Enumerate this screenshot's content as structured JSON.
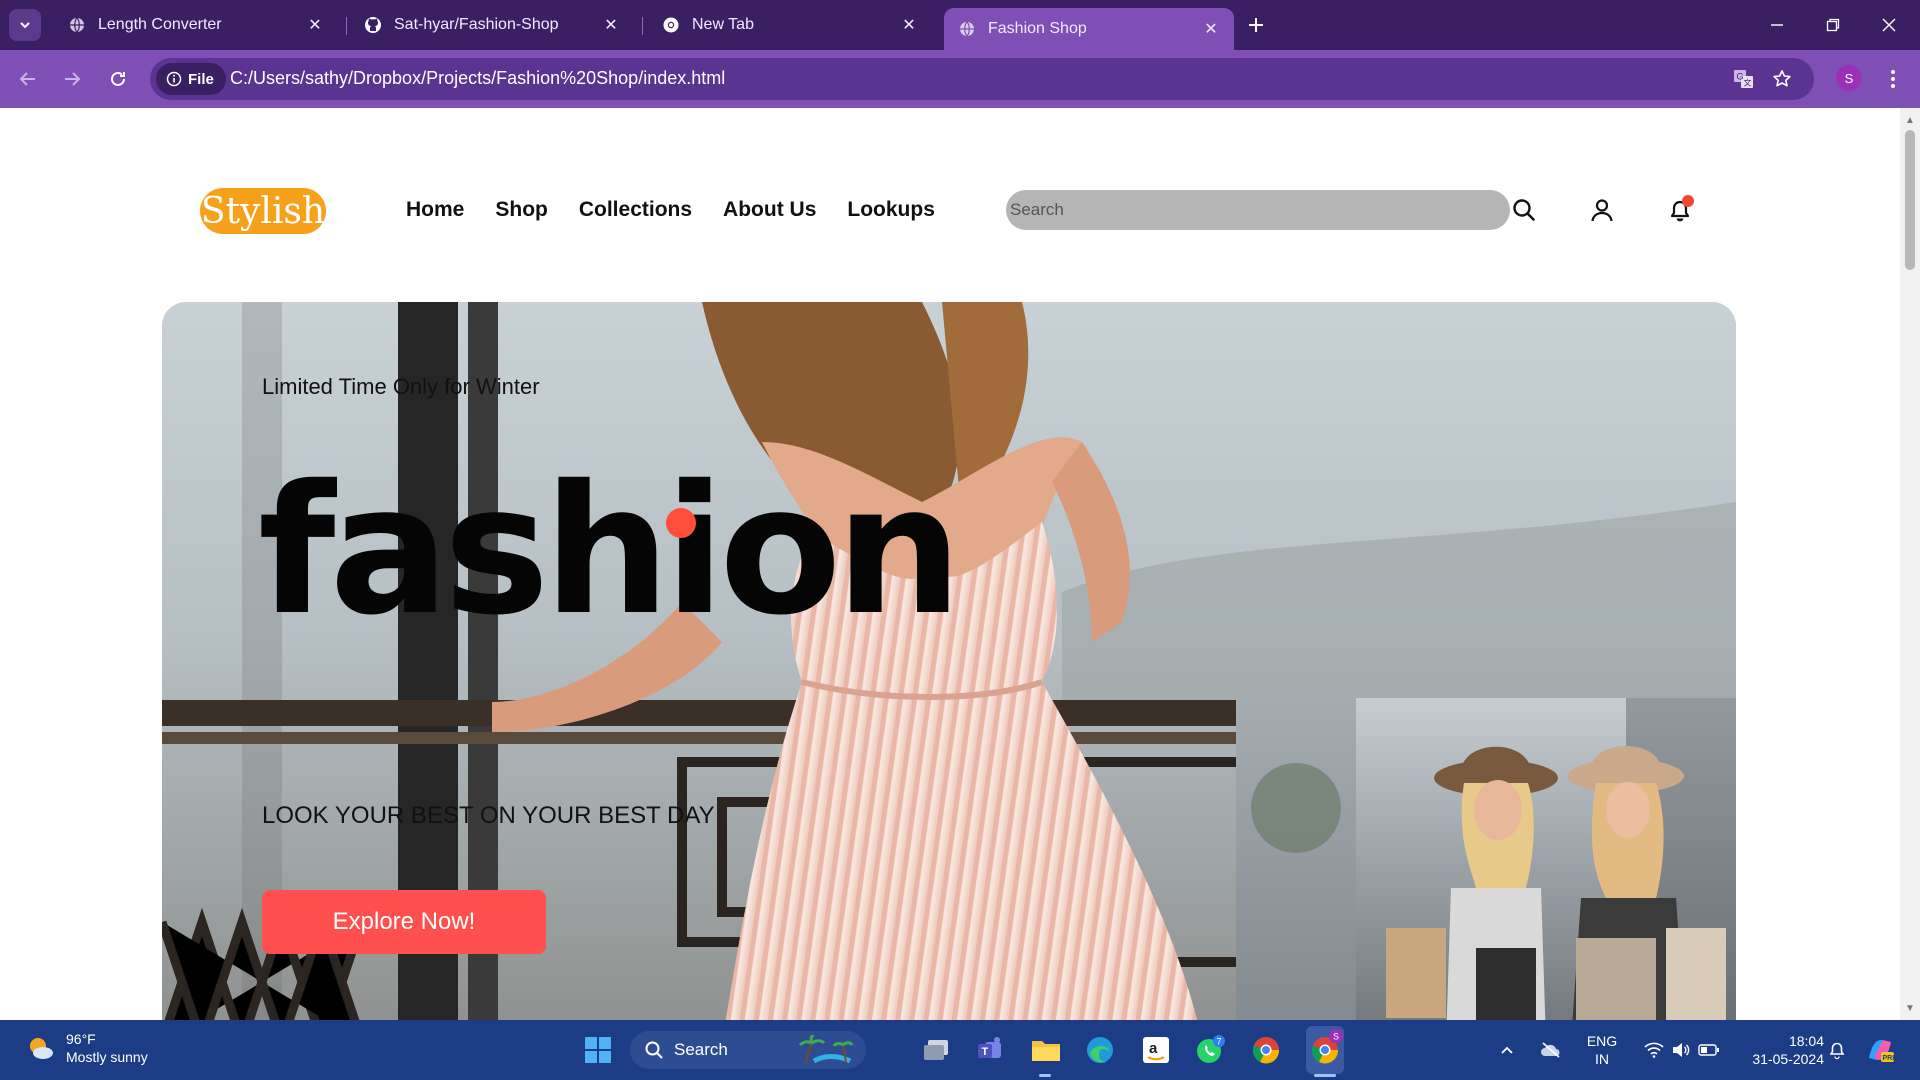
{
  "browser": {
    "tabs": [
      {
        "title": "Length Converter",
        "icon": "globe-icon"
      },
      {
        "title": "Sat-hyar/Fashion-Shop",
        "icon": "github-icon"
      },
      {
        "title": "New Tab",
        "icon": "chrome-icon"
      },
      {
        "title": "Fashion Shop",
        "icon": "globe-icon",
        "active": true
      }
    ],
    "address": {
      "chip_label": "File",
      "url": "C:/Users/sathy/Dropbox/Projects/Fashion%20Shop/index.html"
    },
    "profile_initial": "S",
    "colors": {
      "tabbar": "#3b1f63",
      "toolbar": "#7e4fb5",
      "omnibox": "#5b3390"
    }
  },
  "site": {
    "logo": "Stylish",
    "nav": [
      "Home",
      "Shop",
      "Collections",
      "About Us",
      "Lookups"
    ],
    "search": {
      "placeholder": "Search"
    },
    "hero": {
      "tagline": "Limited Time Only for Winter",
      "title": "fashion",
      "subtitle": "LOOK YOUR BEST ON YOUR BEST DAY",
      "cta": "Explore Now!"
    },
    "colors": {
      "logo_bg": "#f7a01b",
      "accent": "#ff4f3a",
      "cta": "#ff4f4f"
    }
  },
  "taskbar": {
    "weather": {
      "temp": "96°F",
      "condition": "Mostly sunny"
    },
    "search_label": "Search",
    "whatsapp_badge": "7",
    "chrome_badge": "S",
    "language": {
      "lang": "ENG",
      "region": "IN"
    },
    "clock": {
      "time": "18:04",
      "date": "31-05-2024"
    }
  }
}
